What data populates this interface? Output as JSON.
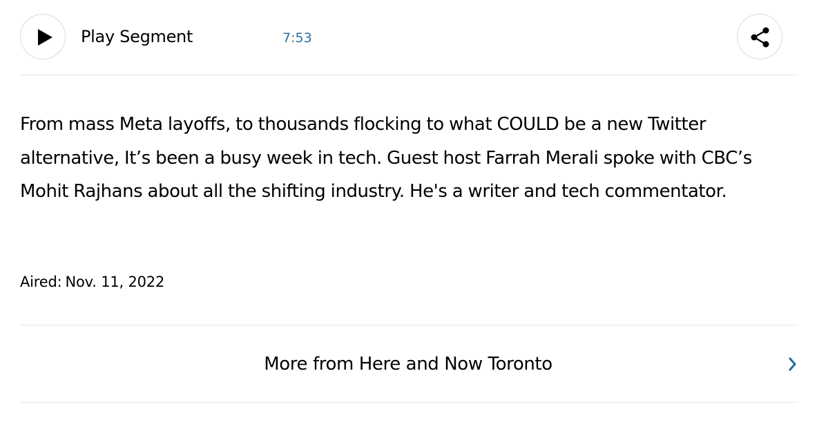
{
  "player": {
    "play_label": "Play Segment",
    "duration": "7:53",
    "play_icon": "play-icon",
    "share_icon": "share-icon",
    "duration_color": "#2a6fa0"
  },
  "segment": {
    "description": "From mass Meta layoffs, to thousands flocking to what COULD be a new Twitter alternative, It’s been a busy week in tech. Guest host Farrah Merali spoke with CBC’s Mohit Rajhans about all the shifting industry. He's a writer and tech commentator.",
    "aired_label": "Aired:",
    "aired_date": "Nov. 11, 2022"
  },
  "more": {
    "label": "More from Here and Now Toronto",
    "icon": "chevron-right-icon",
    "accent_color": "#2a6fa0"
  }
}
